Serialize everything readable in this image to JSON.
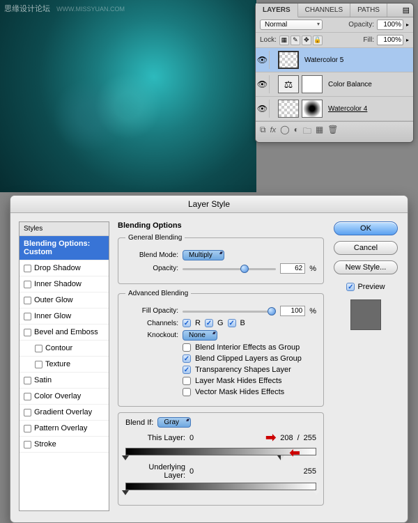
{
  "watermark": {
    "text": "思缘设计论坛",
    "url": "WWW.MISSYUAN.COM"
  },
  "layersPanel": {
    "tabs": [
      "LAYERS",
      "CHANNELS",
      "PATHS"
    ],
    "activeTab": 0,
    "blendMode": "Normal",
    "opacityLabel": "Opacity:",
    "opacityValue": "100%",
    "lockLabel": "Lock:",
    "fillLabel": "Fill:",
    "fillValue": "100%",
    "layers": [
      {
        "name": "Watercolor 5",
        "selected": true
      },
      {
        "name": "Color Balance"
      },
      {
        "name": "Watercolor 4",
        "underline": true
      }
    ]
  },
  "dialog": {
    "title": "Layer Style",
    "stylesHeader": "Styles",
    "styleItems": [
      {
        "label": "Blending Options: Custom",
        "selected": true,
        "noCheckbox": true
      },
      {
        "label": "Drop Shadow"
      },
      {
        "label": "Inner Shadow"
      },
      {
        "label": "Outer Glow"
      },
      {
        "label": "Inner Glow"
      },
      {
        "label": "Bevel and Emboss"
      },
      {
        "label": "Contour",
        "indent": true
      },
      {
        "label": "Texture",
        "indent": true
      },
      {
        "label": "Satin"
      },
      {
        "label": "Color Overlay"
      },
      {
        "label": "Gradient Overlay"
      },
      {
        "label": "Pattern Overlay"
      },
      {
        "label": "Stroke"
      }
    ],
    "optionsTitle": "Blending Options",
    "general": {
      "legend": "General Blending",
      "blendModeLabel": "Blend Mode:",
      "blendModeValue": "Multiply",
      "opacityLabel": "Opacity:",
      "opacityValue": "62",
      "pct": "%"
    },
    "advanced": {
      "legend": "Advanced Blending",
      "fillOpacityLabel": "Fill Opacity:",
      "fillOpacityValue": "100",
      "channelsLabel": "Channels:",
      "chR": "R",
      "chG": "G",
      "chB": "B",
      "knockoutLabel": "Knockout:",
      "knockoutValue": "None",
      "opt1": "Blend Interior Effects as Group",
      "opt2": "Blend Clipped Layers as Group",
      "opt3": "Transparency Shapes Layer",
      "opt4": "Layer Mask Hides Effects",
      "opt5": "Vector Mask Hides Effects"
    },
    "blendIf": {
      "label": "Blend If:",
      "value": "Gray",
      "thisLayerLabel": "This Layer:",
      "thisBlack": "0",
      "thisWhiteA": "208",
      "thisWhiteB": "255",
      "underlyingLabel": "Underlying Layer:",
      "underBlack": "0",
      "underWhite": "255"
    },
    "buttons": {
      "ok": "OK",
      "cancel": "Cancel",
      "newStyle": "New Style...",
      "preview": "Preview"
    }
  }
}
